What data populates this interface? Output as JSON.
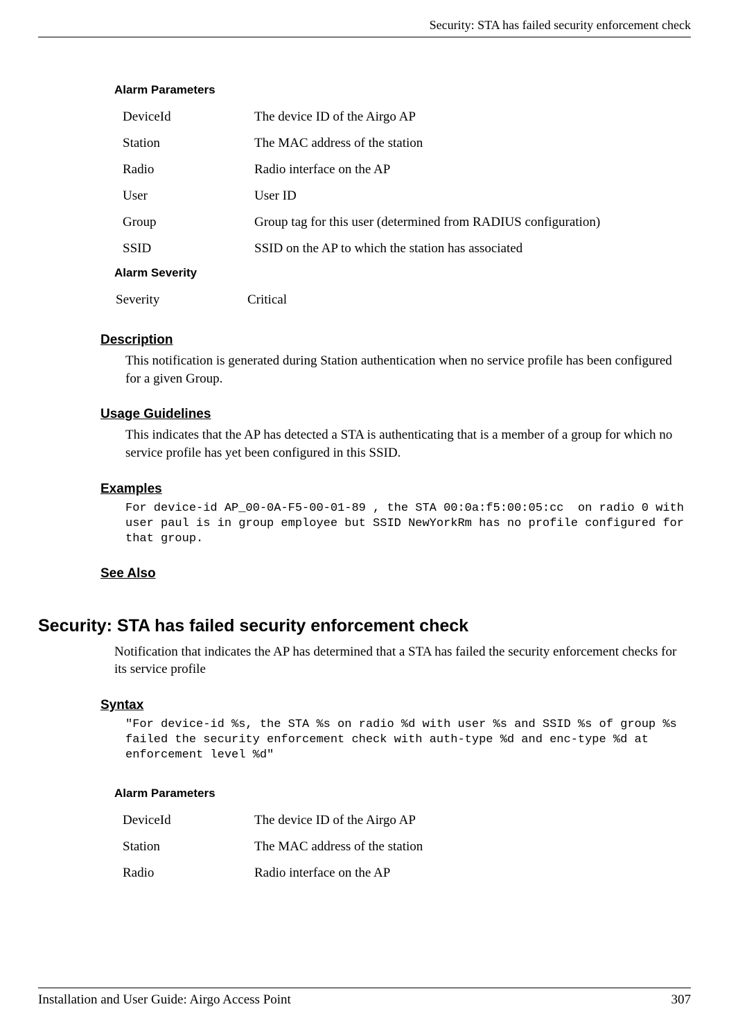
{
  "header": {
    "title": "Security: STA has failed security enforcement check"
  },
  "section1": {
    "alarm_parameters_heading": "Alarm Parameters",
    "params": [
      {
        "name": "DeviceId",
        "desc": "The device ID of the Airgo AP"
      },
      {
        "name": "Station",
        "desc": "The MAC address of the station"
      },
      {
        "name": "Radio",
        "desc": "Radio interface on the AP"
      },
      {
        "name": "User",
        "desc": "User ID"
      },
      {
        "name": "Group",
        "desc": "Group tag for this user (determined from RADIUS configuration)"
      },
      {
        "name": "SSID",
        "desc": "SSID on the AP to which the station has associated"
      }
    ],
    "alarm_severity_heading": "Alarm Severity",
    "severity_label": "Severity",
    "severity_value": "Critical",
    "description_heading": "Description",
    "description_body": "This notification is generated during Station authentication when no service profile has been configured for a given Group.",
    "usage_heading": "Usage Guidelines",
    "usage_body": "This indicates that the AP has detected a STA is authenticating that is a member of a group for which no service profile has yet been configured in this SSID.",
    "examples_heading": "Examples",
    "examples_body": "For device-id AP_00-0A-F5-00-01-89 , the STA 00:0a:f5:00:05:cc  on radio 0 with user paul is in group employee but SSID NewYorkRm has no profile configured for that group.",
    "see_also_heading": "See Also"
  },
  "section2": {
    "title": "Security: STA has failed security enforcement check",
    "intro": "Notification that indicates the AP has determined that a STA has failed the security enforcement checks for its service profile",
    "syntax_heading": "Syntax",
    "syntax_body": "\"For device-id %s, the STA %s on radio %d with user %s and SSID %s of group %s failed the security enforcement check with auth-type %d and enc-type %d at enforcement level %d\"",
    "alarm_parameters_heading": "Alarm Parameters",
    "params": [
      {
        "name": "DeviceId",
        "desc": "The device ID of the Airgo AP"
      },
      {
        "name": "Station",
        "desc": "The MAC address of the station"
      },
      {
        "name": "Radio",
        "desc": "Radio interface on the AP"
      }
    ]
  },
  "footer": {
    "left": "Installation and User Guide: Airgo Access Point",
    "right": "307"
  }
}
